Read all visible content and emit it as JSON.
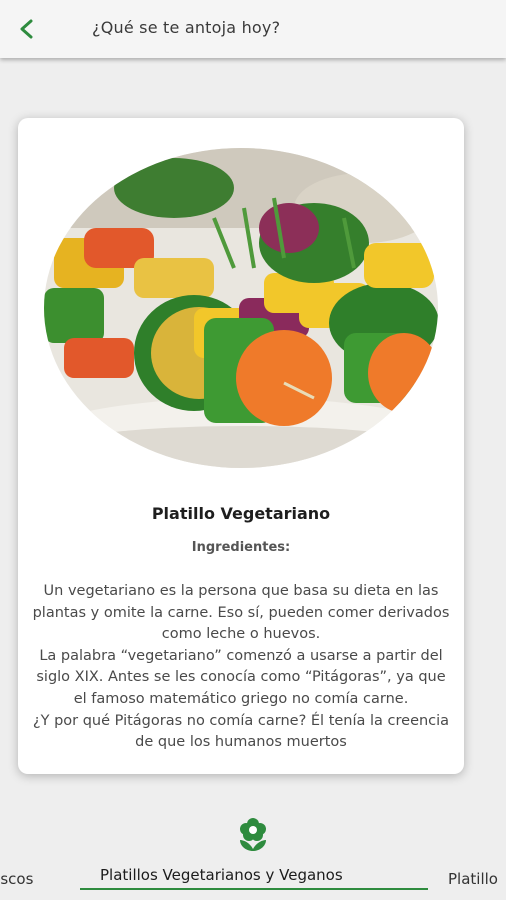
{
  "appbar": {
    "back_icon": "back-arrow-icon",
    "title": "¿Qué se te antoja hoy?",
    "accent": "#2e8b3e"
  },
  "card": {
    "image_icon": "vegetable-skewers-photo",
    "title": "Platillo Vegetariano",
    "subtitle": "Ingredientes:",
    "description": [
      "Un vegetariano es la persona que basa su dieta en las plantas y omite la carne. Eso sí, pueden comer derivados como leche o huevos.",
      "La palabra “vegetariano” comenzó a usarse a partir del siglo XIX. Antes se les conocía como “Pitágoras”, ya que el famoso matemático griego no comía carne.",
      "¿Y por qué Pitágoras no comía carne? Él tenía la creencia de que los humanos muertos"
    ]
  },
  "tabs": {
    "icon": "flower-icon",
    "prev_label": "riscos",
    "active_label": "Platillos Vegetarianos y Veganos",
    "next_label": "Platillo"
  }
}
